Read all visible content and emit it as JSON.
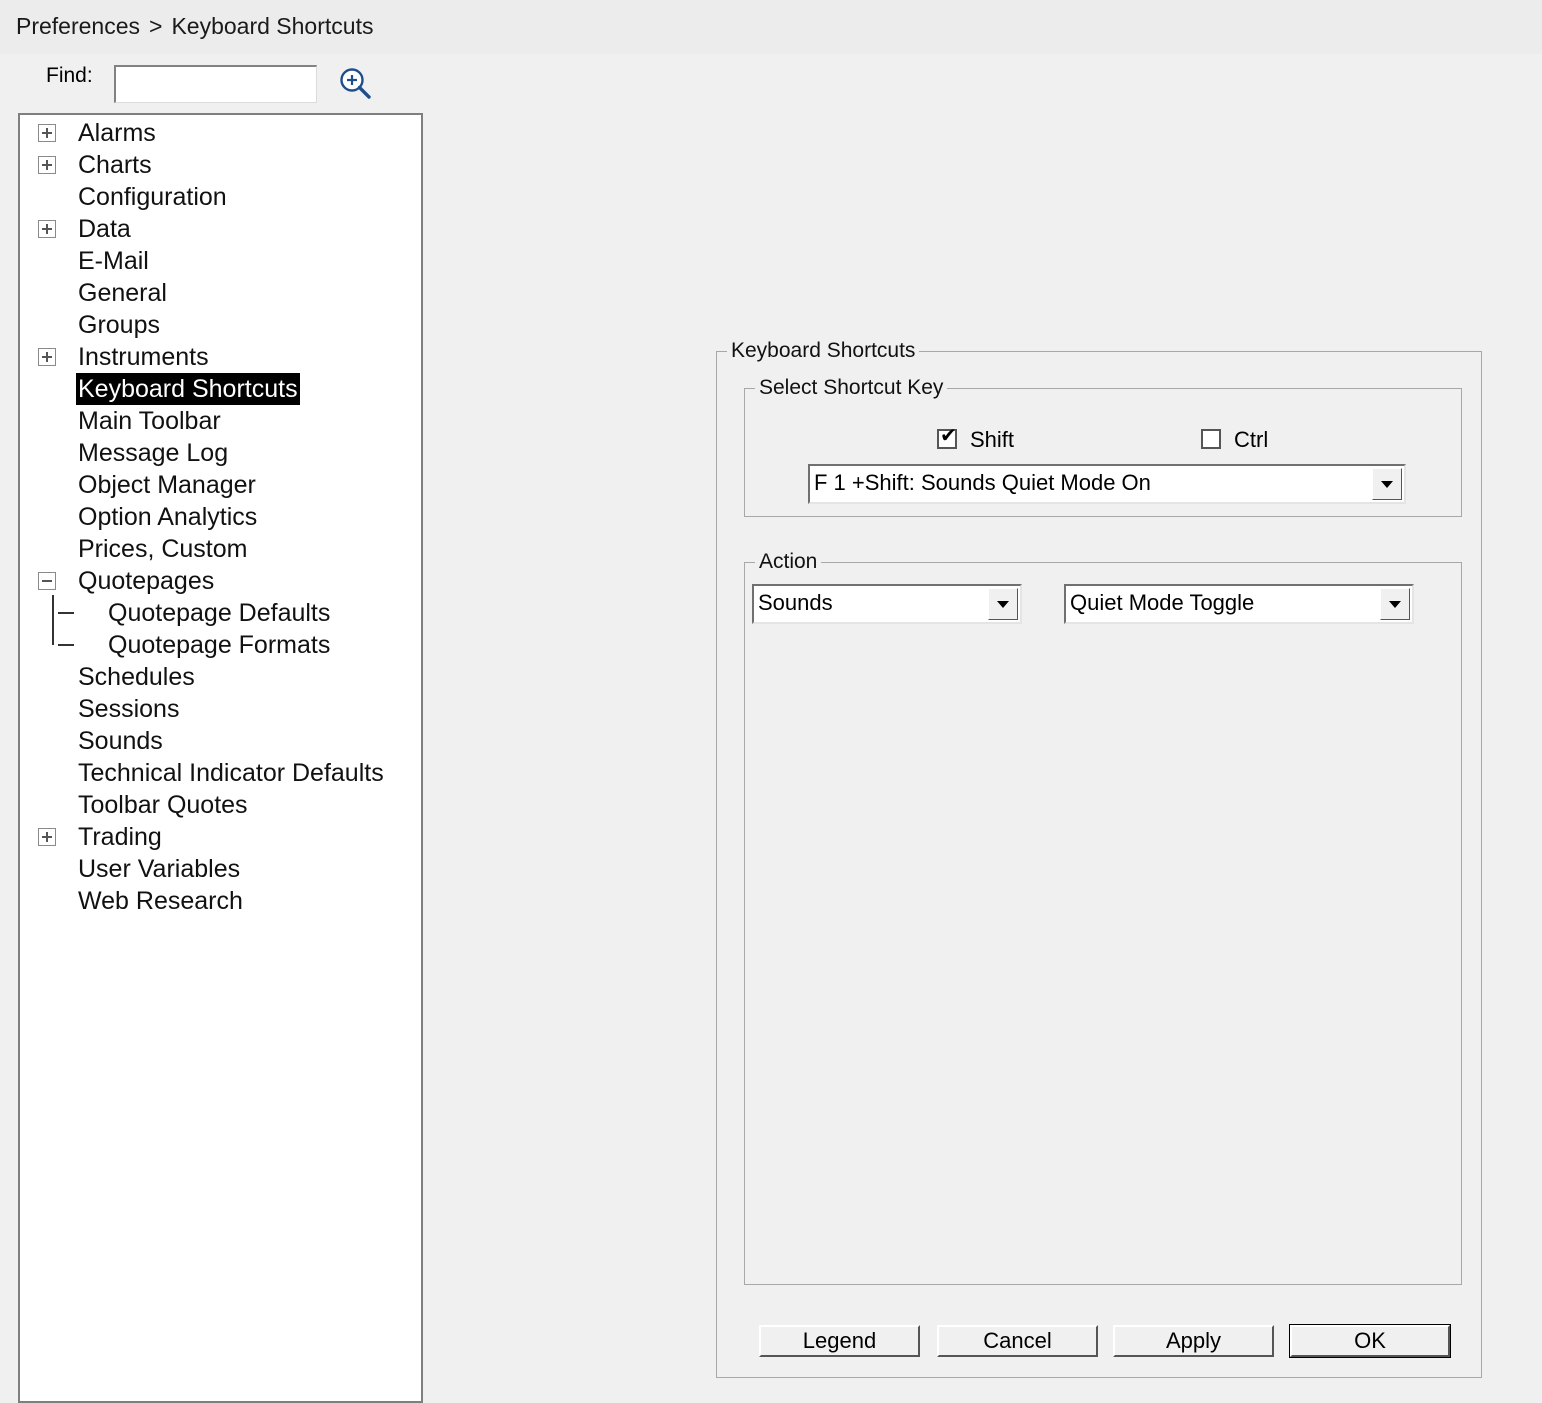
{
  "breadcrumb": {
    "parent": "Preferences",
    "separator": ">",
    "current": "Keyboard Shortcuts"
  },
  "find": {
    "label": "Find:",
    "value": "",
    "icon": "zoom-in-icon"
  },
  "tree": [
    {
      "label": "Alarms",
      "expander": "plus"
    },
    {
      "label": "Charts",
      "expander": "plus"
    },
    {
      "label": "Configuration"
    },
    {
      "label": "Data",
      "expander": "plus"
    },
    {
      "label": "E-Mail"
    },
    {
      "label": "General"
    },
    {
      "label": "Groups"
    },
    {
      "label": "Instruments",
      "expander": "plus"
    },
    {
      "label": "Keyboard Shortcuts",
      "selected": true
    },
    {
      "label": "Main Toolbar"
    },
    {
      "label": "Message Log"
    },
    {
      "label": "Object Manager"
    },
    {
      "label": "Option Analytics"
    },
    {
      "label": "Prices, Custom"
    },
    {
      "label": "Quotepages",
      "expander": "minus"
    },
    {
      "label": "Quotepage Defaults",
      "child": true
    },
    {
      "label": "Quotepage Formats",
      "child": true
    },
    {
      "label": "Schedules"
    },
    {
      "label": "Sessions"
    },
    {
      "label": "Sounds"
    },
    {
      "label": "Technical Indicator Defaults"
    },
    {
      "label": "Toolbar Quotes"
    },
    {
      "label": "Trading",
      "expander": "plus"
    },
    {
      "label": "User Variables"
    },
    {
      "label": "Web Research"
    }
  ],
  "panel": {
    "title": "Keyboard Shortcuts",
    "select_key": {
      "title": "Select Shortcut Key",
      "shift": {
        "label": "Shift",
        "checked": true
      },
      "ctrl": {
        "label": "Ctrl",
        "checked": false
      },
      "shortcut_value": "F 1 +Shift: Sounds Quiet Mode On"
    },
    "action": {
      "title": "Action",
      "category_value": "Sounds",
      "command_value": "Quiet Mode Toggle"
    }
  },
  "buttons": {
    "legend": "Legend",
    "cancel": "Cancel",
    "apply": "Apply",
    "ok": "OK"
  }
}
